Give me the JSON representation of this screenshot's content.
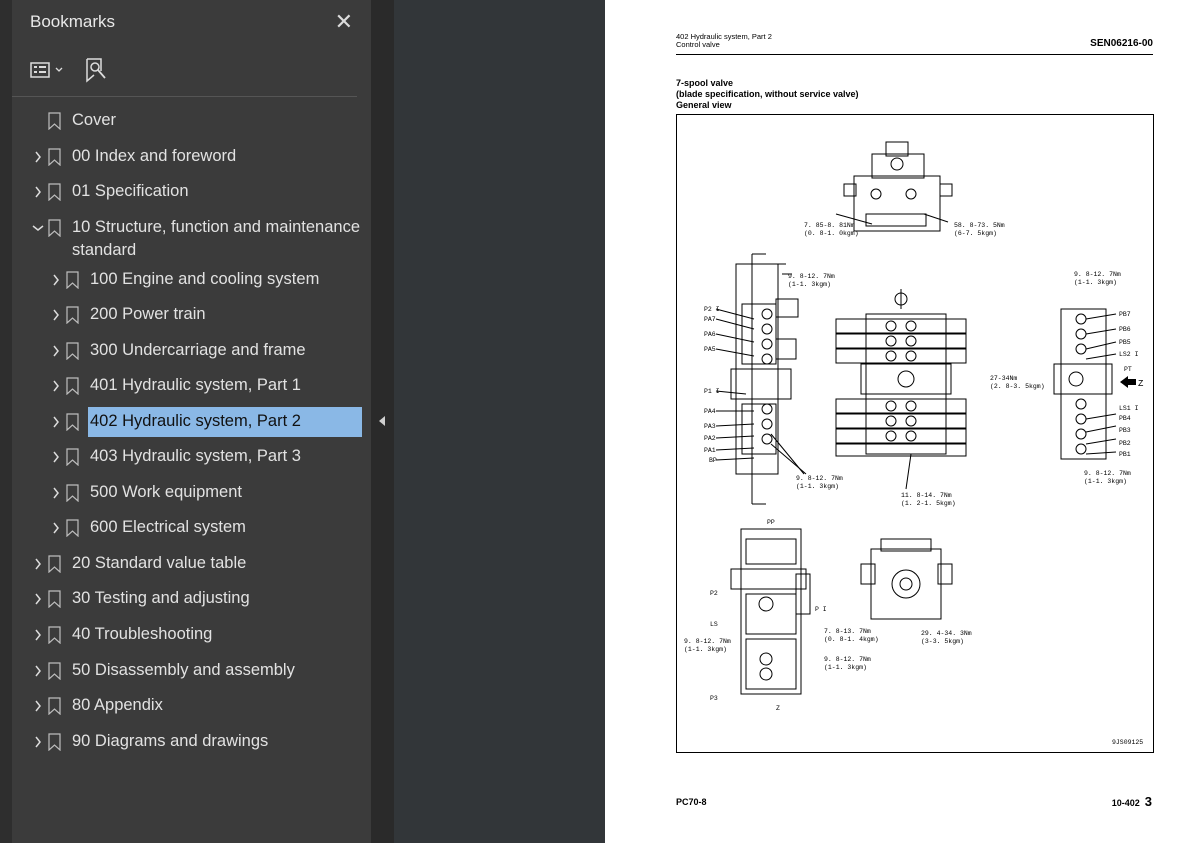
{
  "sidebar": {
    "title": "Bookmarks",
    "bookmarks": [
      {
        "label": "Cover"
      },
      {
        "label": "00 Index and foreword"
      },
      {
        "label": "01 Specification"
      },
      {
        "label": "10 Structure, function and maintenance"
      },
      {
        "label": "standard"
      },
      {
        "label": "100 Engine and cooling system"
      },
      {
        "label": "200 Power train"
      },
      {
        "label": "300 Undercarriage and frame"
      },
      {
        "label": "401 Hydraulic system, Part 1"
      },
      {
        "label": "402 Hydraulic system, Part 2"
      },
      {
        "label": "403 Hydraulic system, Part 3"
      },
      {
        "label": "500 Work equipment"
      },
      {
        "label": "600 Electrical system"
      },
      {
        "label": "20 Standard value table"
      },
      {
        "label": "30 Testing and adjusting"
      },
      {
        "label": "40 Troubleshooting"
      },
      {
        "label": "50 Disassembly and assembly"
      },
      {
        "label": "80 Appendix"
      },
      {
        "label": "90 Diagrams and drawings"
      }
    ]
  },
  "document": {
    "header_left_line1": "402 Hydraulic system, Part 2",
    "header_left_line2": "Control valve",
    "header_right": "SEN06216-00",
    "heading_line1": "7-spool valve",
    "heading_line2": "(blade specification, without service valve)",
    "heading_line3": "General view",
    "figure_code": "9JS09125",
    "footer_left": "PC70-8",
    "footer_right_prefix": "10-402",
    "footer_page": "3",
    "labels": {
      "t1": "7. 85-8. 81Nm",
      "t2": "(0. 8-1. 0kgm)",
      "t3": "58. 8-73. 5Nm",
      "t4": "(6-7. 5kgm)",
      "t5": "9. 8-12. 7Nm",
      "t6": "(1-1. 3kgm)",
      "t7": "27-34Nm",
      "t8": "(2. 8-3. 5kgm)",
      "t9": "11. 8-14. 7Nm",
      "t10": "(1. 2-1. 5kgm)",
      "t11": "7. 8-13. 7Nm",
      "t12": "(0. 8-1. 4kgm)",
      "t13": "29. 4-34. 3Nm",
      "t14": "(3-3. 5kgm)",
      "p21": "P2 I",
      "pa7": "PA7",
      "pa6": "PA6",
      "pa5": "PA5",
      "p11": "P1 I",
      "pa4": "PA4",
      "pa3": "PA3",
      "pa2": "PA2",
      "pa1": "PA1",
      "bp": "BP",
      "pb7": "PB7",
      "pb6": "PB6",
      "pb5": "PB5",
      "ls2": "LS2 I",
      "pt": "PT",
      "ls1": "LS1 I",
      "pb4": "PB4",
      "pb3": "PB3",
      "pb2": "PB2",
      "pb1": "PB1",
      "pp": "PP",
      "p2": "P2",
      "p1": "P I",
      "ls": "LS",
      "p3": "P3",
      "z": "Z"
    }
  }
}
